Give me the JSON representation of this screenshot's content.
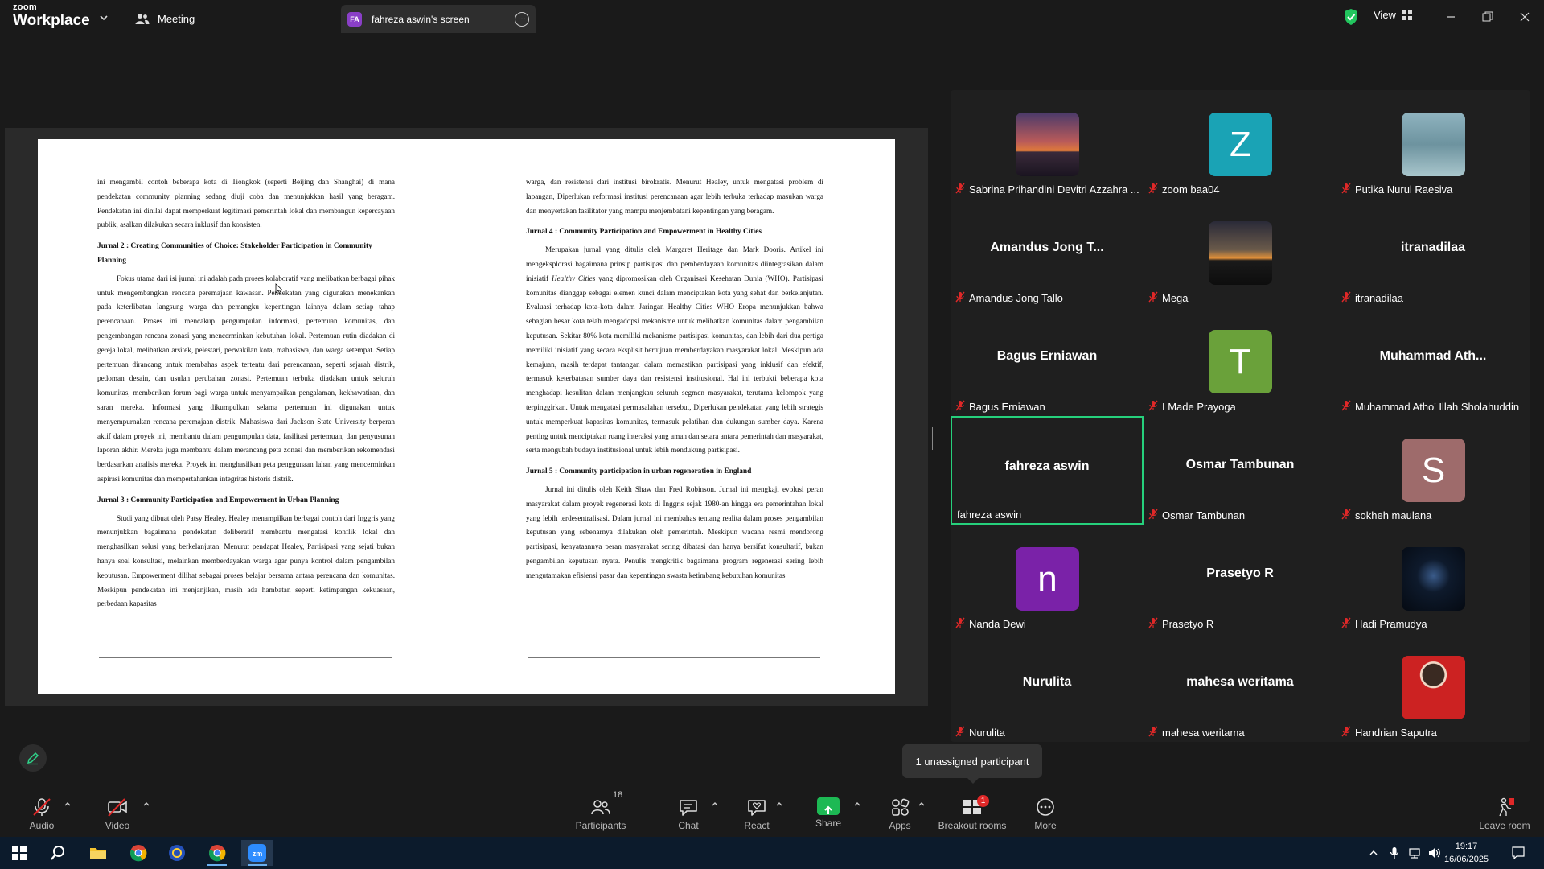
{
  "titlebar": {
    "logo_line1": "zoom",
    "logo_line2": "Workplace",
    "meeting_label": "Meeting",
    "share_tab_initials": "FA",
    "share_tab_label": "fahreza aswin's screen",
    "view_label": "View"
  },
  "document": {
    "left_col": {
      "intro": "ini mengambil contoh beberapa kota di Tiongkok (seperti Beijing dan Shanghai) di mana pendekatan community planning sedang diuji coba dan menunjukkan hasil yang beragam. Pendekatan ini dinilai dapat memperkuat legitimasi pemerintah lokal dan membangun kepercayaan publik, asalkan dilakukan secara inklusif dan konsisten.",
      "heading2": "Jurnal 2 : Creating Communities of Choice: Stakeholder Participation in Community Planning",
      "para2": "Fokus utama dari isi jurnal ini adalah pada proses kolaboratif yang melibatkan berbagai pihak untuk mengembangkan rencana peremajaan kawasan. Pendekatan yang digunakan menekankan pada keterlibatan langsung warga dan pemangku kepentingan lainnya dalam setiap tahap perencanaan. Proses ini mencakup pengumpulan informasi, pertemuan komunitas, dan pengembangan rencana zonasi yang mencerminkan kebutuhan lokal. Pertemuan rutin diadakan di gereja lokal, melibatkan arsitek, pelestari, perwakilan kota, mahasiswa, dan warga setempat. Setiap pertemuan dirancang untuk membahas aspek tertentu dari perencanaan, seperti sejarah distrik, pedoman desain, dan usulan perubahan zonasi. Pertemuan terbuka diadakan untuk seluruh komunitas, memberikan forum bagi warga untuk menyampaikan pengalaman, kekhawatiran, dan saran mereka. Informasi yang dikumpulkan selama pertemuan ini digunakan untuk menyempurnakan rencana peremajaan distrik. Mahasiswa dari Jackson State University berperan aktif dalam proyek ini, membantu dalam pengumpulan data, fasilitasi pertemuan, dan penyusunan laporan akhir. Mereka juga membantu dalam merancang peta zonasi dan memberikan rekomendasi berdasarkan analisis mereka. Proyek ini menghasilkan peta penggunaan lahan yang mencerminkan aspirasi komunitas dan mempertahankan integritas historis distrik.",
      "heading3": "Jurnal 3 : Community Participation and Empowerment in Urban Planning",
      "para3": "Studi yang dibuat oleh Patsy Healey. Healey menampilkan berbagai contoh dari Inggris yang menunjukkan bagaimana pendekatan deliberatif membantu mengatasi konflik lokal dan menghasilkan solusi yang berkelanjutan. Menurut pendapat Healey, Partisipasi yang sejati bukan hanya soal konsultasi, melainkan memberdayakan warga agar punya kontrol dalam pengambilan keputusan. Empowerment dilihat sebagai proses belajar bersama antara perencana dan komunitas. Meskipun pendekatan ini menjanjikan, masih ada hambatan seperti ketimpangan kekuasaan, perbedaan kapasitas"
    },
    "right_col": {
      "intro": "warga, dan resistensi dari institusi birokratis. Menurut Healey, untuk mengatasi problem di lapangan, Diperlukan reformasi institusi perencanaan agar lebih terbuka terhadap masukan warga dan menyertakan fasilitator yang mampu menjembatani kepentingan yang beragam.",
      "heading4": "Jurnal 4 : Community Participation and Empowerment in Healthy Cities",
      "para4_a": "Merupakan jurnal yang ditulis oleh Margaret Heritage dan Mark Dooris. Artikel ini mengeksplorasi bagaimana prinsip partisipasi dan pemberdayaan komunitas diintegrasikan dalam inisiatif ",
      "para4_italic": "Healthy Cities",
      "para4_b": " yang dipromosikan oleh Organisasi Kesehatan Dunia (WHO). Partisipasi komunitas dianggap sebagai elemen kunci dalam menciptakan kota yang sehat dan berkelanjutan. Evaluasi terhadap kota-kota dalam Jaringan Healthy Cities WHO Eropa menunjukkan bahwa sebagian besar kota telah mengadopsi mekanisme untuk melibatkan komunitas dalam pengambilan keputusan. Sekitar 80% kota memiliki mekanisme partisipasi komunitas, dan lebih dari dua pertiga memiliki inisiatif yang secara eksplisit bertujuan memberdayakan masyarakat lokal. Meskipun ada kemajuan, masih terdapat tantangan dalam memastikan partisipasi yang inklusif dan efektif, termasuk keterbatasan sumber daya dan resistensi institusional. Hal ini terbukti beberapa kota menghadapi kesulitan dalam menjangkau seluruh segmen masyarakat, terutama kelompok yang terpinggirkan. Untuk mengatasi permasalahan tersebut, Diperlukan pendekatan yang lebih strategis untuk memperkuat kapasitas komunitas, termasuk pelatihan dan dukungan sumber daya. Karena penting untuk menciptakan ruang interaksi yang aman dan setara antara pemerintah dan masyarakat, serta mengubah budaya institusional untuk lebih mendukung partisipasi.",
      "heading5": "Jurnal 5 : Community participation in urban regeneration in England",
      "para5": "Jurnal ini ditulis oleh Keith Shaw dan Fred Robinson. Jurnal ini mengkaji evolusi peran masyarakat dalam proyek regenerasi kota di Inggris sejak 1980-an hingga era pemerintahan lokal yang lebih terdesentralisasi. Dalam jurnal ini membahas tentang realita dalam proses pengambilan keputusan yang sebenarnya dilakukan oleh pemerintah. Meskipun wacana resmi mendorong partisipasi, kenyataannya peran masyarakat sering dibatasi dan hanya bersifat konsultatif, bukan pengambilan keputusan nyata. Penulis mengkritik bagaimana program regenerasi sering lebih mengutamakan efisiensi pasar dan kepentingan swasta ketimbang kebutuhan komunitas"
    }
  },
  "gallery": {
    "tiles": [
      {
        "label": "Sabrina Prihandini Devitri Azzahra ...",
        "kind": "photo-sunset",
        "muted": true
      },
      {
        "label": "zoom baa04",
        "kind": "letter",
        "letter": "Z",
        "color": "#1aa3b5",
        "muted": true
      },
      {
        "label": "Putika Nurul Raesiva",
        "kind": "photo-rain",
        "muted": true
      },
      {
        "label": "Amandus Jong Tallo",
        "kind": "name",
        "big": "Amandus Jong T...",
        "muted": true
      },
      {
        "label": "Mega",
        "kind": "photo-dusk",
        "muted": true
      },
      {
        "label": "itranadilaa",
        "kind": "name",
        "big": "itranadilaa",
        "muted": true
      },
      {
        "label": "Bagus Erniawan",
        "kind": "name",
        "big": "Bagus Erniawan",
        "muted": true
      },
      {
        "label": "I Made Prayoga",
        "kind": "letter",
        "letter": "T",
        "color": "#6aa13a",
        "muted": true
      },
      {
        "label": "Muhammad Atho' Illah Sholahuddin",
        "kind": "name",
        "big": "Muhammad Ath...",
        "muted": true
      },
      {
        "label": "fahreza aswin",
        "kind": "name",
        "big": "fahreza aswin",
        "muted": false,
        "active": true
      },
      {
        "label": "Osmar Tambunan",
        "kind": "name",
        "big": "Osmar Tambunan",
        "muted": true
      },
      {
        "label": "sokheh maulana",
        "kind": "letter",
        "letter": "S",
        "color": "#9e6b6b",
        "muted": true
      },
      {
        "label": "Nanda Dewi",
        "kind": "letter",
        "letter": "n",
        "color": "#7a22a8",
        "muted": true
      },
      {
        "label": "Prasetyo R",
        "kind": "name",
        "big": "Prasetyo R",
        "muted": true
      },
      {
        "label": "Hadi Pramudya",
        "kind": "photo-person-dark",
        "muted": true
      },
      {
        "label": "Nurulita",
        "kind": "name",
        "big": "Nurulita",
        "muted": true
      },
      {
        "label": "mahesa weritama",
        "kind": "name",
        "big": "mahesa weritama",
        "muted": true
      },
      {
        "label": "Handrian Saputra",
        "kind": "photo-person-red",
        "muted": true
      }
    ],
    "tooltip": "1 unassigned participant"
  },
  "toolbar": {
    "audio": "Audio",
    "video": "Video",
    "participants": "Participants",
    "participants_count": "18",
    "chat": "Chat",
    "react": "React",
    "share": "Share",
    "apps": "Apps",
    "breakout": "Breakout rooms",
    "breakout_badge": "1",
    "more": "More",
    "leave": "Leave room"
  },
  "taskbar": {
    "time": "19:17",
    "date": "16/06/2025"
  },
  "colors": {
    "active_border": "#26d07c",
    "muted_red": "#e02828",
    "share_green": "#1db954"
  }
}
